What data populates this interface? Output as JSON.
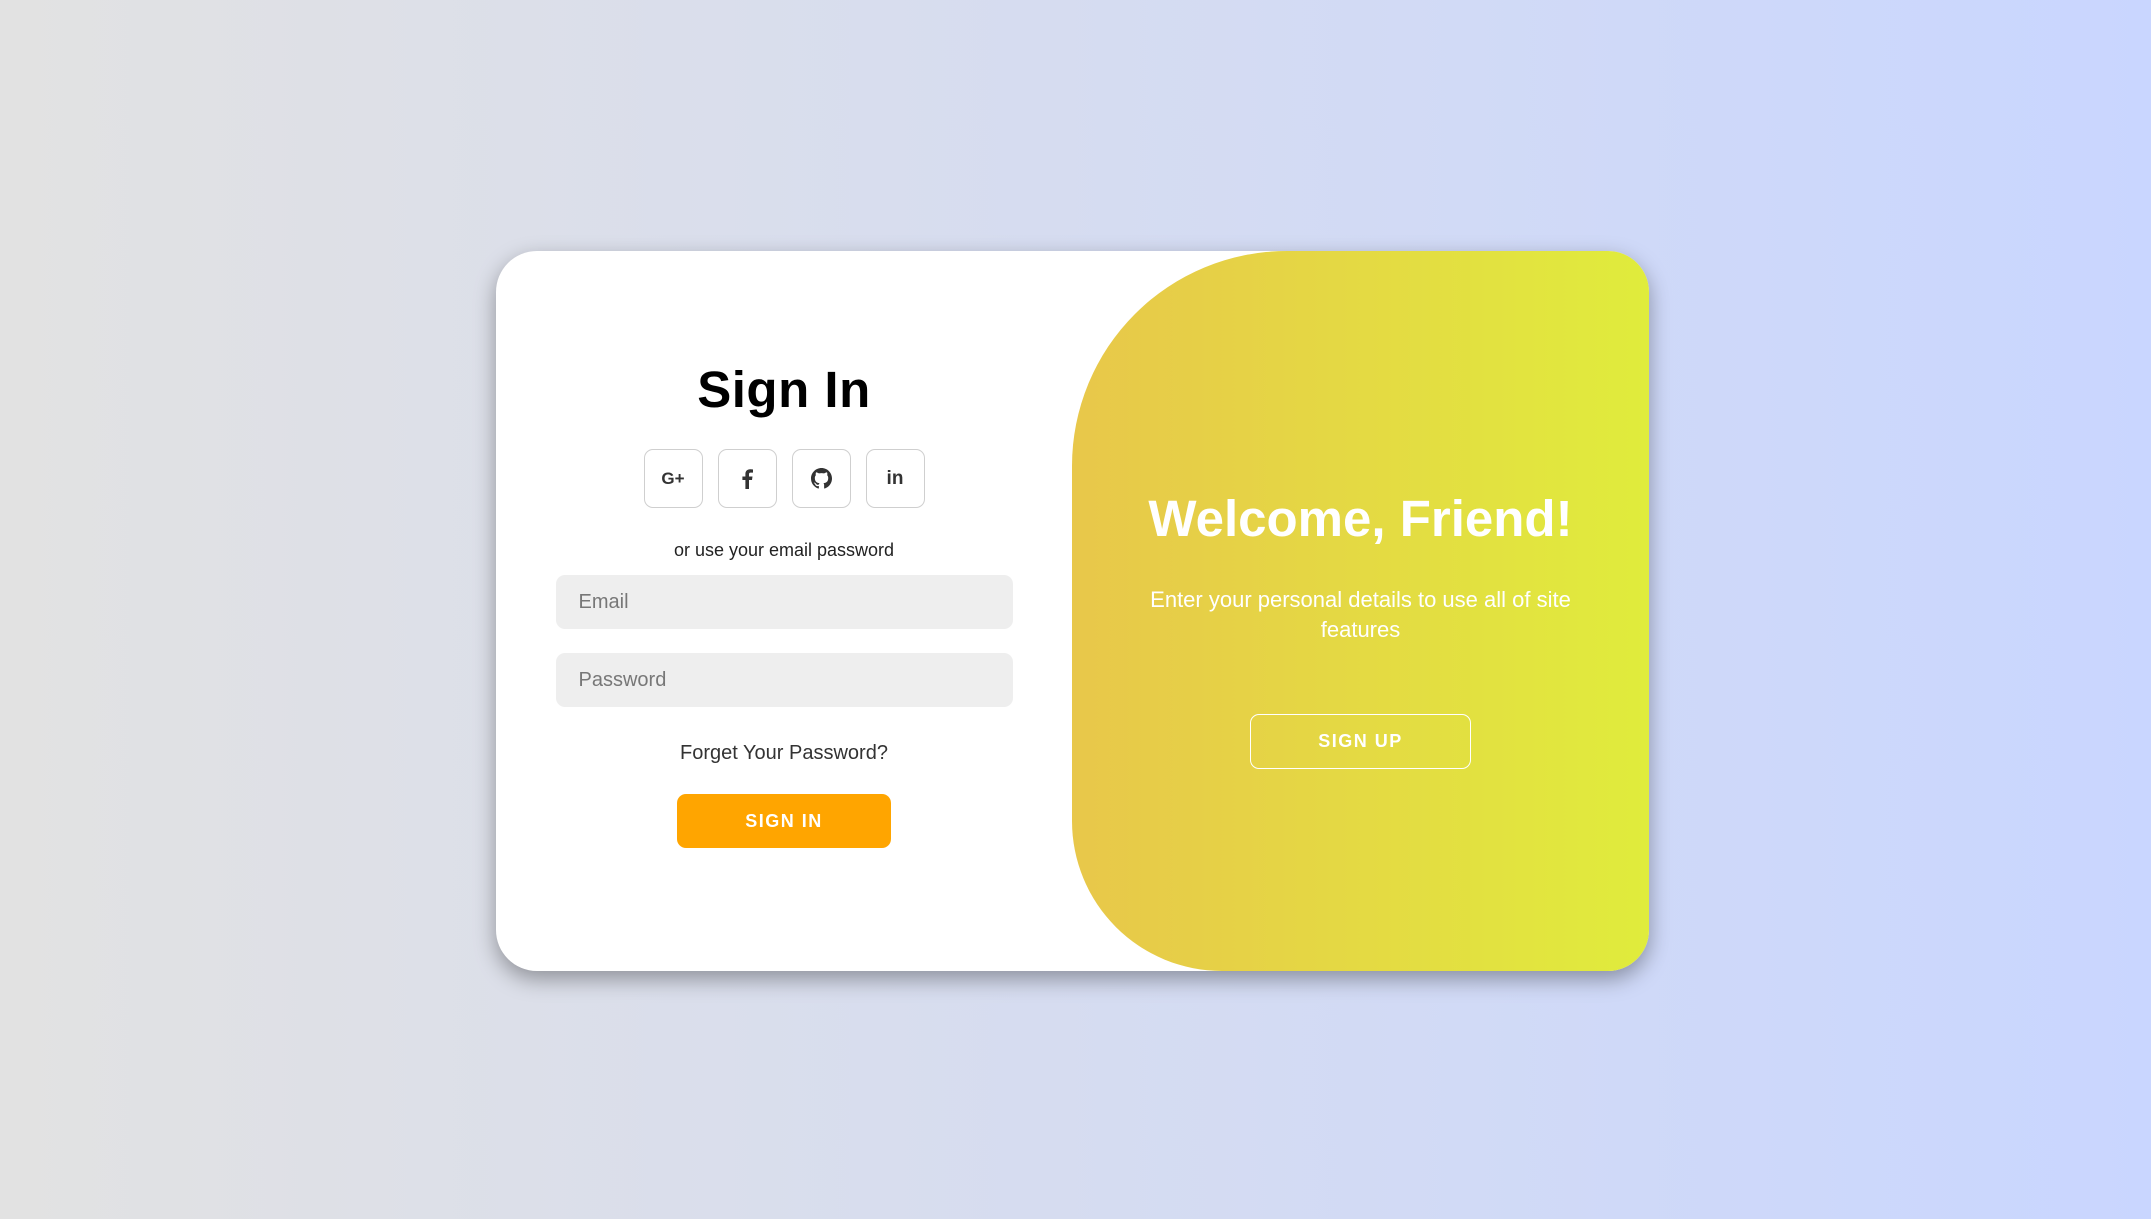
{
  "signin": {
    "title": "Sign In",
    "social": [
      {
        "icon": "google-plus-icon",
        "text": "G+"
      },
      {
        "icon": "facebook-icon"
      },
      {
        "icon": "github-icon"
      },
      {
        "icon": "linkedin-icon",
        "text": "in"
      }
    ],
    "or_text": "or use your email password",
    "email_placeholder": "Email",
    "password_placeholder": "Password",
    "forgot_label": "Forget Your Password?",
    "button_label": "SIGN IN"
  },
  "toggle": {
    "title": "Welcome, Friend!",
    "description": "Enter your personal details to use all of site features",
    "button_label": "SIGN UP"
  },
  "colors": {
    "accent": "#ffa500",
    "panel_gradient_start": "#e8c74a",
    "panel_gradient_end": "#e0ec3c"
  }
}
